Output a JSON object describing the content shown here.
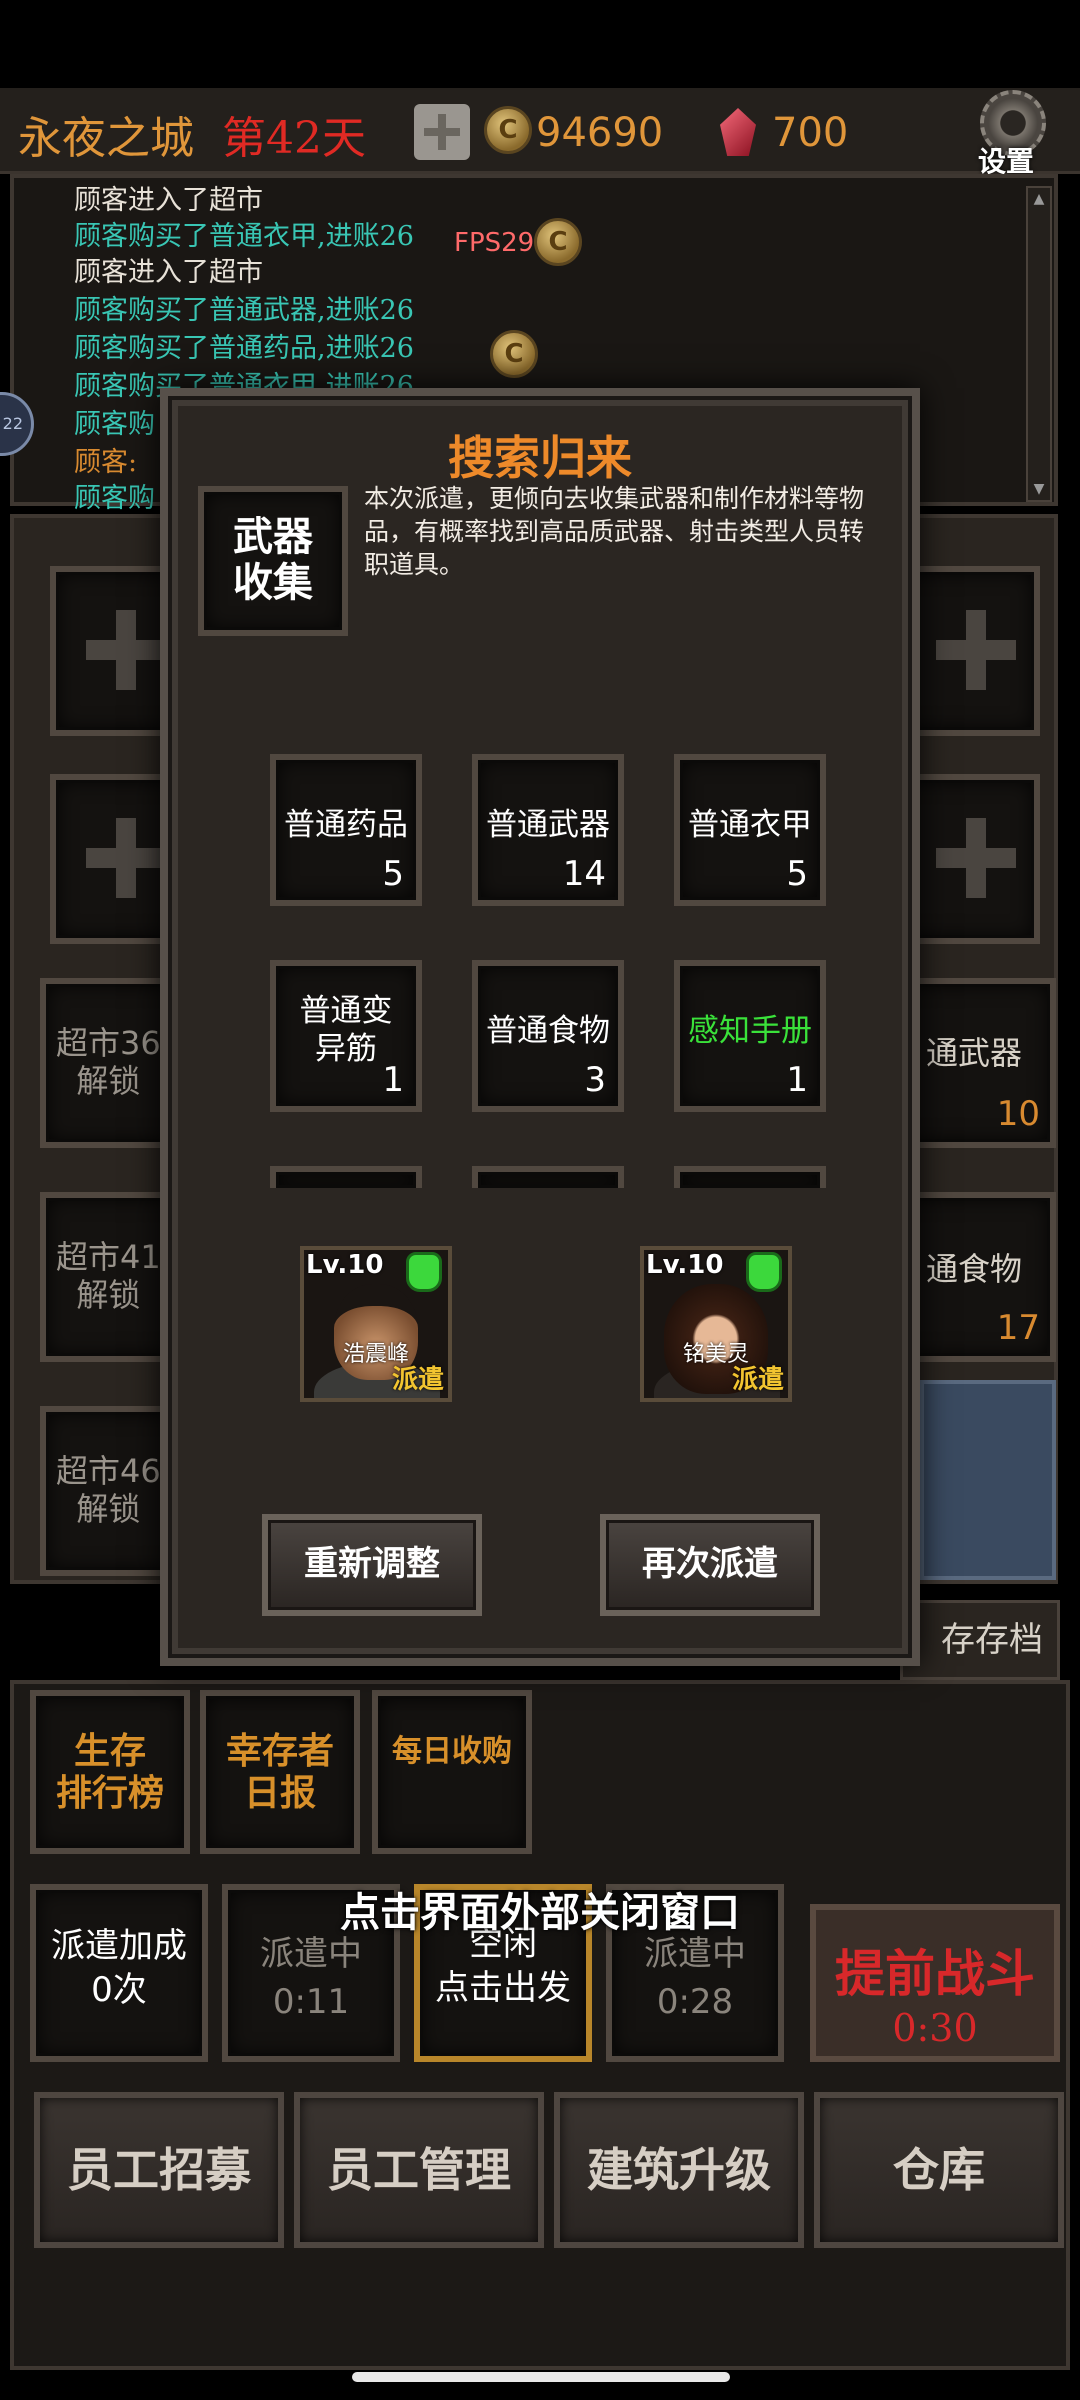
{
  "topbar": {
    "city": "永夜之城",
    "day": "第42天",
    "coins": "94690",
    "gems": "700",
    "settings": "设置"
  },
  "log": {
    "lines": [
      {
        "text": "顾客进入了超市",
        "color": "#e8e2d8"
      },
      {
        "text": "顾客购买了普通衣甲,进账26",
        "color": "#39c6b4"
      },
      {
        "text": "顾客进入了超市",
        "color": "#e8e2d8"
      },
      {
        "text": "顾客购买了普通武器,进账26",
        "color": "#39c6b4"
      },
      {
        "text": "顾客购买了普通药品,进账26",
        "color": "#39c6b4"
      },
      {
        "text": "顾客购买了普通衣甲,进账26",
        "color": "#39c6b4"
      },
      {
        "text": "顾客购",
        "color": "#39c6b4"
      },
      {
        "text": "顾客:",
        "color": "#d88a30"
      },
      {
        "text": "顾客购",
        "color": "#39c6b4"
      }
    ],
    "fps": "FPS29",
    "side_badge": "22"
  },
  "background": {
    "left_slots": [
      {
        "line1": "超市36",
        "line2": "解锁"
      },
      {
        "line1": "超市41",
        "line2": "解锁"
      },
      {
        "line1": "超市46",
        "line2": "解锁"
      }
    ],
    "right_items": [
      {
        "name": "通武器",
        "count": "10"
      },
      {
        "name": "通食物",
        "count": "17"
      }
    ],
    "save_label": "存存档"
  },
  "modal": {
    "title": "搜索归来",
    "type_line1": "武器",
    "type_line2": "收集",
    "description": "本次派遣，更倾向去收集武器和制作材料等物品，有概率找到高品质武器、射击类型人员转职道具。",
    "items": [
      {
        "name": "普通药品",
        "count": "5"
      },
      {
        "name": "普通武器",
        "count": "14"
      },
      {
        "name": "普通衣甲",
        "count": "5"
      },
      {
        "name": "普通变异筋",
        "count": "1"
      },
      {
        "name": "普通食物",
        "count": "3"
      },
      {
        "name": "感知手册",
        "count": "1"
      }
    ],
    "heroes": [
      {
        "level": "Lv.10",
        "name": "浩震峰",
        "tag": "派遣"
      },
      {
        "level": "Lv.10",
        "name": "铭美灵",
        "tag": "派遣"
      }
    ],
    "readjust_label": "重新调整",
    "redispatch_label": "再次派遣"
  },
  "features": {
    "ranking": [
      "生存",
      "排行榜"
    ],
    "daily": [
      "幸存者",
      "日报"
    ],
    "harvest": "每日收购"
  },
  "dispatch": {
    "bonus_line1": "派遣加成",
    "bonus_line2": "0次",
    "slot1_status": "派遣中",
    "slot1_time": "0:11",
    "slot2_status": "空闲",
    "slot2_action": "点击出发",
    "slot3_status": "派遣中",
    "slot3_time": "0:28",
    "fight_label": "提前战斗",
    "fight_time": "0:30"
  },
  "close_tip": "点击界面外部关闭窗口",
  "bottom_nav": {
    "recruit": "员工招募",
    "manage": "员工管理",
    "upgrade": "建筑升级",
    "warehouse": "仓库"
  },
  "colors": {
    "accent_orange": "#ee8a2a",
    "log_teal": "#39c6b4",
    "special_green": "#3ae23a",
    "danger_red": "#d8282a"
  }
}
